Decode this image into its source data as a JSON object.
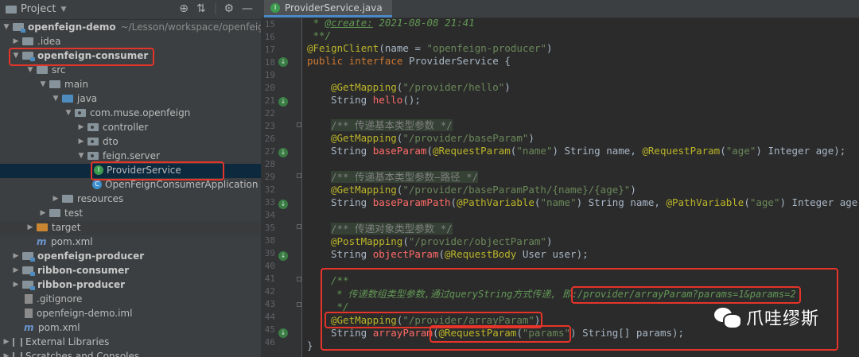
{
  "project_panel": {
    "title": "Project",
    "rows": [
      {
        "label": "openfeign-demo",
        "extra": "~/Lesson/workspace/openfeign-demo"
      },
      {
        "label": ".idea"
      },
      {
        "label": "openfeign-consumer"
      },
      {
        "label": "src"
      },
      {
        "label": "main"
      },
      {
        "label": "java"
      },
      {
        "label": "com.muse.openfeign"
      },
      {
        "label": "controller"
      },
      {
        "label": "dto"
      },
      {
        "label": "feign.server"
      },
      {
        "label": "ProviderService"
      },
      {
        "label": "OpenFeignConsumerApplication"
      },
      {
        "label": "resources"
      },
      {
        "label": "test"
      },
      {
        "label": "target"
      },
      {
        "label": "pom.xml"
      },
      {
        "label": "openfeign-producer"
      },
      {
        "label": "ribbon-consumer"
      },
      {
        "label": "ribbon-producer"
      },
      {
        "label": ".gitignore"
      },
      {
        "label": "openfeign-demo.iml"
      },
      {
        "label": "pom.xml"
      },
      {
        "label": "External Libraries"
      },
      {
        "label": "Scratches and Consoles"
      }
    ]
  },
  "editor": {
    "tab_title": "ProviderService.java",
    "line_numbers": [
      "15",
      "16",
      "17",
      "18",
      "19",
      "20",
      "21",
      "22",
      "23",
      "26",
      "27",
      "28",
      "29",
      "32",
      "33",
      "34",
      "35",
      "38",
      "39",
      "40",
      "41",
      "42",
      "43",
      "44",
      "45",
      "46"
    ],
    "code": {
      "l15_prefix": " * ",
      "l15_tag": "@create:",
      "l15_rest": " 2021-08-08 21:41",
      "l16": " **/",
      "l17_ann": "@FeignClient",
      "l17_a": "(name = ",
      "l17_str": "\"openfeign-producer\"",
      "l17_b": ")",
      "l18_kw": "public interface ",
      "l18_rest": "ProviderService {",
      "l20_ann": "@GetMapping",
      "l20_a": "(",
      "l20_str": "\"/provider/hello\"",
      "l20_b": ")",
      "l21_type": "String ",
      "l21_fn": "hello",
      "l21_rest": "();",
      "l23": "/** 传递基本类型参数 */",
      "l26_ann": "@GetMapping",
      "l26_a": "(",
      "l26_str": "\"/provider/baseParam\"",
      "l26_b": ")",
      "l27_type": "String ",
      "l27_fn": "baseParam",
      "l27_a": "(",
      "l27_ann1": "@RequestParam",
      "l27_b": "(",
      "l27_str1": "\"name\"",
      "l27_c": ") String name, ",
      "l27_ann2": "@RequestParam",
      "l27_d": "(",
      "l27_str2": "\"age\"",
      "l27_e": ") Integer age);",
      "l29": "/** 传递基本类型参数—路径 */",
      "l32_ann": "@GetMapping",
      "l32_a": "(",
      "l32_str": "\"/provider/baseParamPath/{name}/{age}\"",
      "l32_b": ")",
      "l33_type": "String ",
      "l33_fn": "baseParamPath",
      "l33_a": "(",
      "l33_ann1": "@PathVariable",
      "l33_b": "(",
      "l33_str1": "\"name\"",
      "l33_c": ") String name, ",
      "l33_ann2": "@PathVariable",
      "l33_d": "(",
      "l33_str2": "\"age\"",
      "l33_e": ") Integer age);",
      "l35": "/** 传递对象类型参数 */",
      "l38_ann": "@PostMapping",
      "l38_a": "(",
      "l38_str": "\"/provider/objectParam\"",
      "l38_b": ")",
      "l39_type": "String ",
      "l39_fn": "objectParam",
      "l39_a": "(",
      "l39_ann": "@RequestBody",
      "l39_b": " User user);",
      "l41": "/**",
      "l42_a": " * 传递数组类型参数,通过queryString方式传递, 即:",
      "l42_b": "/provider/arrayParam?params=1&params=2",
      "l43": " */",
      "l44_ann": "@GetMapping",
      "l44_a": "(",
      "l44_str": "\"/provider/arrayParam\"",
      "l44_b": ")",
      "l45_type": "String ",
      "l45_fn": "arrayParam",
      "l45_a": "(",
      "l45_ann": "@RequestParam",
      "l45_b": "(",
      "l45_str": "\"params\"",
      "l45_c": ") String[] params);",
      "l46": "}"
    }
  },
  "watermark": {
    "text": "爪哇缪斯"
  },
  "colors": {
    "highlight_box": "#e5342a",
    "editor_bg": "#2b2b2b",
    "panel_bg": "#3c3f41"
  }
}
